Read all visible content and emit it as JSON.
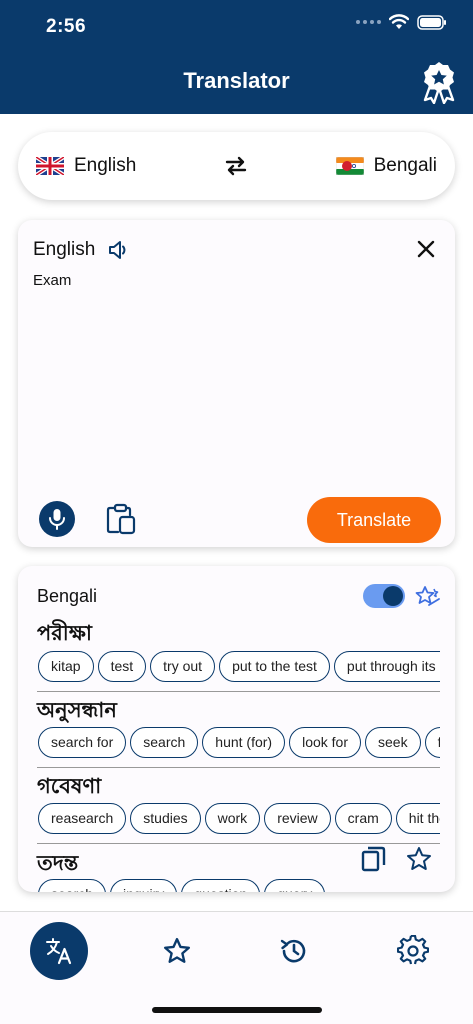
{
  "status": {
    "time": "2:56"
  },
  "app": {
    "title": "Translator"
  },
  "languages": {
    "source": "English",
    "target": "Bengali"
  },
  "input": {
    "language": "English",
    "text": "Exam"
  },
  "actions": {
    "translate_label": "Translate"
  },
  "output": {
    "language": "Bengali",
    "entries": [
      {
        "word": "পরীক্ষা",
        "synonyms": [
          "kitap",
          "test",
          "try out",
          "put to the test",
          "put through its paces"
        ]
      },
      {
        "word": "অনুসন্ধান",
        "synonyms": [
          "search for",
          "search",
          "hunt (for)",
          "look for",
          "seek",
          "forage"
        ]
      },
      {
        "word": "গবেষণা",
        "synonyms": [
          "reasearch",
          "studies",
          "work",
          "review",
          "cram",
          "hit the books"
        ]
      },
      {
        "word": "তদন্ত",
        "synonyms": [
          "search",
          "inquiry",
          "question",
          "query"
        ]
      }
    ]
  },
  "colors": {
    "primary": "#0a3a6b",
    "accent": "#f96b0c",
    "toggle": "#6a9bf0"
  },
  "icons": {
    "header": "award-badge-icon",
    "tabs": [
      "translate-icon",
      "star-icon",
      "history-icon",
      "gear-icon"
    ]
  }
}
